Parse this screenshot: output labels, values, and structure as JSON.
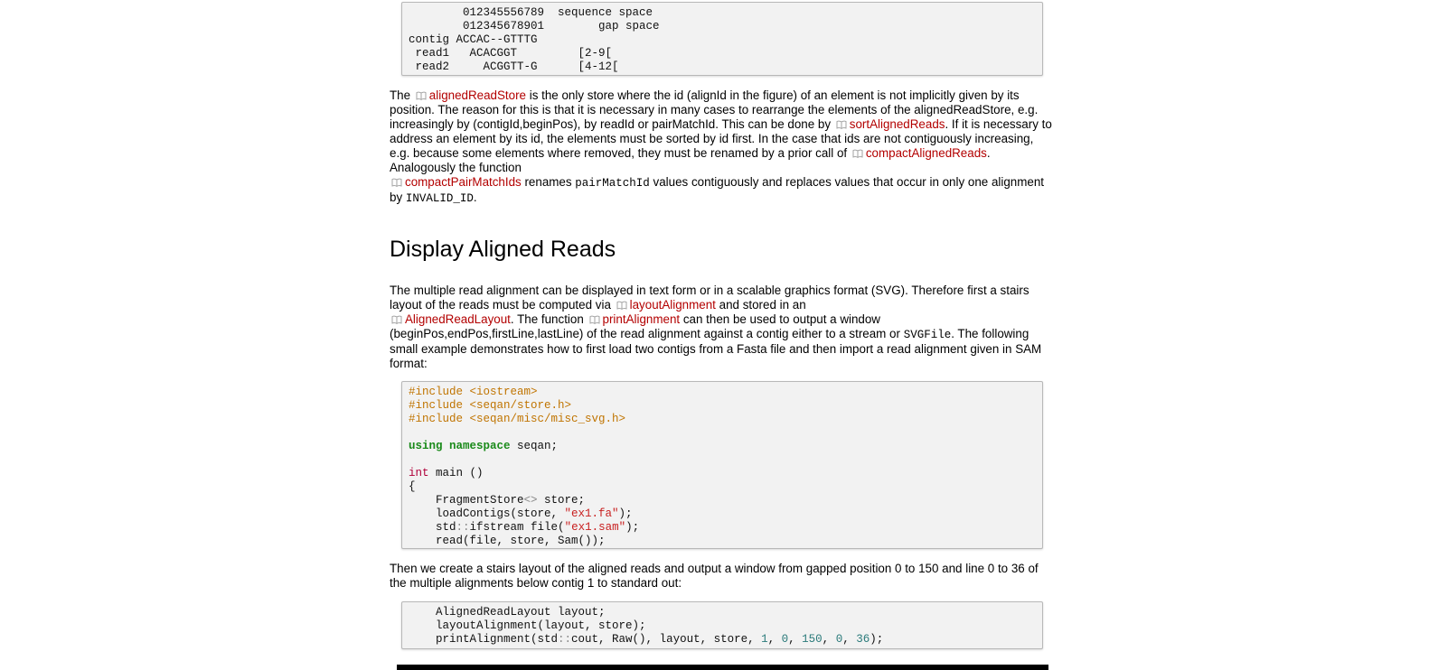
{
  "figure_block": {
    "lines": [
      "        012345556789  sequence space",
      "        012345678901        gap space",
      "contig ACCAC--GTTTG",
      " read1   ACACGGT         [2-9[",
      " read2     ACGGTT-G      [4-12["
    ]
  },
  "para1": {
    "t0": "The ",
    "ref_alignedReadStore": "alignedReadStore",
    "t1": " is the only store where the id (alignId in the figure) of an element is not implicitly given by its position. The reason for this is that it is necessary in many cases to rearrange the elements of the alignedReadStore, e.g. increasingly by (contigId,beginPos), by readId or pairMatchId. This can be done by ",
    "ref_sortAlignedReads": "sortAlignedReads",
    "t2": ". If it is necessary to address an element by its id, the elements must be sorted by id first. In the case that ids are not contiguously increasing, e.g. because some elements where removed, they must be renamed by a prior call of ",
    "ref_compactAlignedReads": "compactAlignedReads",
    "t3": ". Analogously the function ",
    "ref_compactPairMatchIds": "compactPairMatchIds",
    "t4": " renames ",
    "code_pairMatchId": "pairMatchId",
    "t5": " values contiguously and replaces values that occur in only one alignment by ",
    "code_invalid": "INVALID_ID",
    "t6": "."
  },
  "heading": "Display Aligned Reads",
  "para2": {
    "t0": "The multiple read alignment can be displayed in text form or in a scalable graphics format (SVG). Therefore first a stairs layout of the reads must be computed via ",
    "ref_layoutAlignment": "layoutAlignment",
    "t1": " and stored in an ",
    "ref_AlignedReadLayout": "AlignedReadLayout",
    "t2": ". The function ",
    "ref_printAlignment": "printAlignment",
    "t3": " can then be used to output a window (beginPos,endPos,firstLine,lastLine) of the read alignment against a contig either to a stream or ",
    "code_svgfile": "SVGFile",
    "t4": ". The following small example demonstrates how to first load two contigs from a Fasta file and then import a read alignment given in SAM format:"
  },
  "code1": {
    "inc1": "#include <iostream>",
    "inc2": "#include <seqan/store.h>",
    "inc3": "#include <seqan/misc/misc_svg.h>",
    "using_kw1": "using",
    "using_kw2": "namespace",
    "using_rest": " seqan;",
    "main_type": "int",
    "main_rest": " main ()",
    "brace": "{",
    "l1a": "    FragmentStore",
    "l1b": "<>",
    "l1c": " store;",
    "l2a": "    loadContigs(store, ",
    "l2b": "\"ex1.fa\"",
    "l2c": ");",
    "l3a": "    std",
    "l3b": "::",
    "l3c": "ifstream file(",
    "l3d": "\"ex1.sam\"",
    "l3e": ");",
    "l4": "    read(file, store, Sam());"
  },
  "para3": "Then we create a stairs layout of the aligned reads and output a window from gapped position 0 to 150 and line 0 to 36 of the multiple alignments below contig 1 to standard out:",
  "code2": {
    "l1": "    AlignedReadLayout layout;",
    "l2": "    layoutAlignment(layout, store);",
    "l3a": "    printAlignment(std",
    "l3b": "::",
    "l3c": "cout, Raw(), layout, store, ",
    "n1": "1",
    "sep1": ", ",
    "n2": "0",
    "sep2": ", ",
    "n3": "150",
    "sep3": ", ",
    "n4": "0",
    "sep4": ", ",
    "n5": "36",
    "l3d": ");"
  },
  "icons": {
    "doc_link": "book-icon"
  },
  "colors": {
    "link": "#b30000",
    "keyword": "#1a8a1a",
    "preprocessor": "#c07400",
    "type": "#b0003a",
    "string": "#c81e1e",
    "number": "#2a7a7a"
  }
}
